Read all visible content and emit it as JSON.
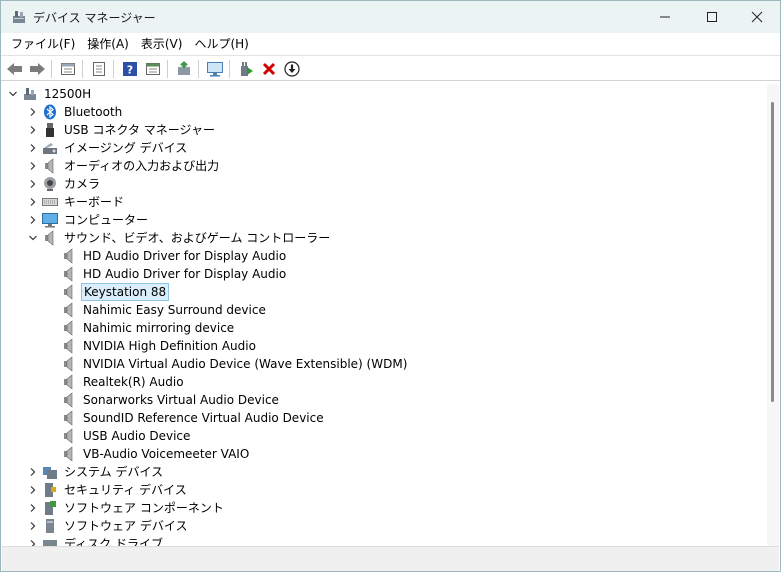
{
  "window": {
    "title": "デバイス マネージャー"
  },
  "menu": [
    {
      "label": "ファイル(F)"
    },
    {
      "label": "操作(A)"
    },
    {
      "label": "表示(V)"
    },
    {
      "label": "ヘルプ(H)"
    }
  ],
  "toolbar_icons": [
    "back-icon",
    "forward-icon",
    "properties-icon",
    "view-icon",
    "help-icon",
    "list-icon",
    "update-driver-icon",
    "scan-hardware-icon",
    "enable-device-icon",
    "uninstall-icon",
    "disable-icon"
  ],
  "tree": {
    "root": {
      "label": "12500H"
    },
    "categories_top": [
      {
        "label": "Bluetooth",
        "icon": "bluetooth-icon"
      },
      {
        "label": "USB コネクタ マネージャー",
        "icon": "usb-icon"
      },
      {
        "label": "イメージング デバイス",
        "icon": "camera-scanner-icon"
      },
      {
        "label": "オーディオの入力および出力",
        "icon": "speaker-icon"
      },
      {
        "label": "カメラ",
        "icon": "webcam-icon"
      },
      {
        "label": "キーボード",
        "icon": "keyboard-icon"
      },
      {
        "label": "コンピューター",
        "icon": "monitor-icon"
      }
    ],
    "expanded": {
      "label": "サウンド、ビデオ、およびゲーム コントローラー",
      "children": [
        {
          "label": "HD Audio Driver for Display Audio"
        },
        {
          "label": "HD Audio Driver for Display Audio"
        },
        {
          "label": "Keystation 88",
          "selected": true
        },
        {
          "label": "Nahimic Easy Surround device"
        },
        {
          "label": "Nahimic mirroring device"
        },
        {
          "label": "NVIDIA High Definition Audio"
        },
        {
          "label": "NVIDIA Virtual Audio Device (Wave Extensible) (WDM)"
        },
        {
          "label": "Realtek(R) Audio"
        },
        {
          "label": "Sonarworks Virtual Audio Device"
        },
        {
          "label": "SoundID Reference Virtual Audio Device"
        },
        {
          "label": "USB Audio Device"
        },
        {
          "label": "VB-Audio Voicemeeter VAIO"
        }
      ]
    },
    "categories_bottom": [
      {
        "label": "システム デバイス",
        "icon": "system-device-icon"
      },
      {
        "label": "セキュリティ デバイス",
        "icon": "security-device-icon"
      },
      {
        "label": "ソフトウェア コンポーネント",
        "icon": "software-component-icon"
      },
      {
        "label": "ソフトウェア デバイス",
        "icon": "software-device-icon"
      },
      {
        "label": "ディスク ドライブ",
        "icon": "disk-drive-icon"
      }
    ]
  },
  "colors": {
    "selection_bg": "#dbeefb",
    "selection_border": "#8cc4ea",
    "uninstall_red": "#d40000"
  }
}
